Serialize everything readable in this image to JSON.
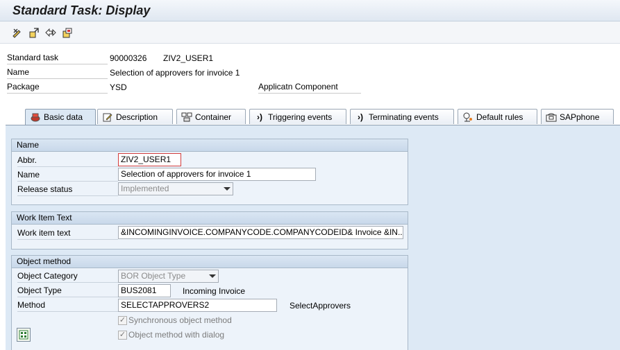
{
  "window": {
    "title": "Standard Task: Display"
  },
  "toolbar": {
    "icons": [
      "change-display-icon",
      "other-object-icon",
      "navigate-icon",
      "where-used-icon"
    ]
  },
  "header": {
    "standard_task": {
      "label": "Standard task",
      "number": "90000326",
      "abbr": "ZIV2_USER1"
    },
    "name": {
      "label": "Name",
      "value": "Selection of approvers for invoice 1"
    },
    "package": {
      "label": "Package",
      "value": "YSD",
      "appl_label": "Applicatn Component"
    }
  },
  "tabs": [
    {
      "label": "Basic data",
      "icon": "basic-data-icon",
      "active": true
    },
    {
      "label": "Description",
      "icon": "description-icon"
    },
    {
      "label": "Container",
      "icon": "container-icon"
    },
    {
      "label": "Triggering events",
      "icon": "triggering-events-icon"
    },
    {
      "label": "Terminating events",
      "icon": "terminating-events-icon"
    },
    {
      "label": "Default rules",
      "icon": "default-rules-icon"
    },
    {
      "label": "SAPphone",
      "icon": "sapphone-icon"
    }
  ],
  "name_group": {
    "title": "Name",
    "abbr_label": "Abbr.",
    "abbr_value": "ZIV2_USER1",
    "name_label": "Name",
    "name_value": "Selection of approvers for invoice 1",
    "release_label": "Release status",
    "release_value": "Implemented"
  },
  "work_item_group": {
    "title": "Work Item Text",
    "text_label": "Work item text",
    "text_value": "&INCOMINGINVOICE.COMPANYCODE.COMPANYCODEID& Invoice &IN..."
  },
  "object_method_group": {
    "title": "Object method",
    "category_label": "Object Category",
    "category_value": "BOR Object Type",
    "type_label": "Object Type",
    "type_value": "BUS2081",
    "type_desc": "Incoming Invoice",
    "method_label": "Method",
    "method_value": "SELECTAPPROVERS2",
    "method_desc": "SelectApprovers",
    "sync_label": "Synchronous object method",
    "dialog_label": "Object method with dialog"
  },
  "colors": {
    "tab_body": "#dde9f5",
    "highlight_border": "#d23c3c"
  }
}
